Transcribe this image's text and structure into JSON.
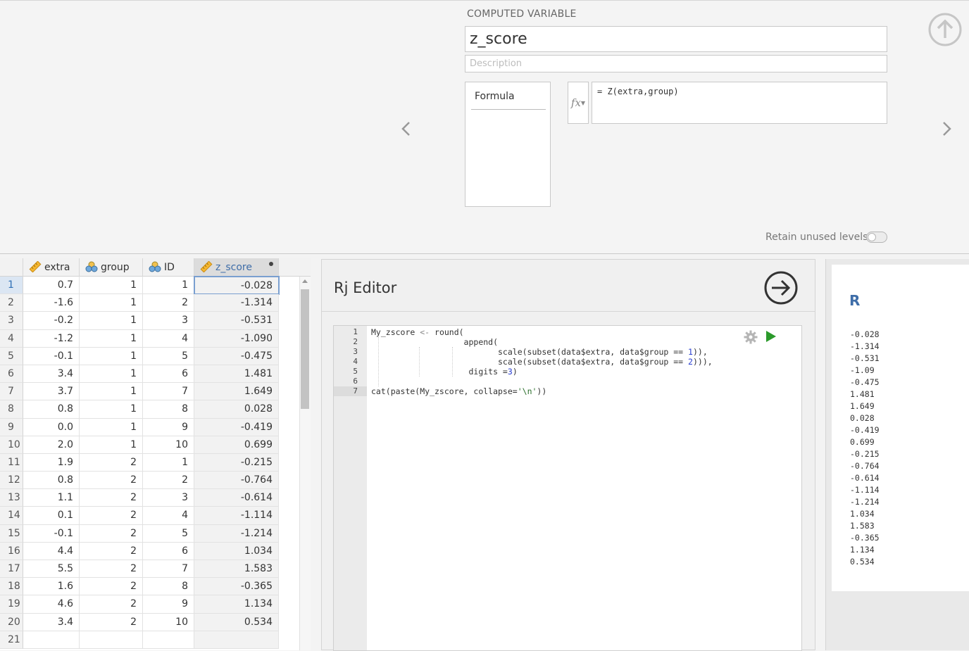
{
  "computed_variable": {
    "section_label": "COMPUTED VARIABLE",
    "name": "z_score",
    "description_placeholder": "Description",
    "formula_tab_label": "Formula",
    "fx_label": "fx",
    "formula_expression": "= Z(extra,group)",
    "retain_unused_levels_label": "Retain unused levels",
    "retain_unused_levels_on": false
  },
  "spreadsheet": {
    "columns": [
      {
        "name": "extra",
        "icon": "ruler-icon"
      },
      {
        "name": "group",
        "icon": "nominal-icon"
      },
      {
        "name": "ID",
        "icon": "nominal-icon"
      },
      {
        "name": "z_score",
        "icon": "ruler-icon",
        "selected": true
      }
    ],
    "rows": [
      [
        "1",
        "0.7",
        "1",
        "1",
        "-0.028"
      ],
      [
        "2",
        "-1.6",
        "1",
        "2",
        "-1.314"
      ],
      [
        "3",
        "-0.2",
        "1",
        "3",
        "-0.531"
      ],
      [
        "4",
        "-1.2",
        "1",
        "4",
        "-1.090"
      ],
      [
        "5",
        "-0.1",
        "1",
        "5",
        "-0.475"
      ],
      [
        "6",
        "3.4",
        "1",
        "6",
        "1.481"
      ],
      [
        "7",
        "3.7",
        "1",
        "7",
        "1.649"
      ],
      [
        "8",
        "0.8",
        "1",
        "8",
        "0.028"
      ],
      [
        "9",
        "0.0",
        "1",
        "9",
        "-0.419"
      ],
      [
        "10",
        "2.0",
        "1",
        "10",
        "0.699"
      ],
      [
        "11",
        "1.9",
        "2",
        "1",
        "-0.215"
      ],
      [
        "12",
        "0.8",
        "2",
        "2",
        "-0.764"
      ],
      [
        "13",
        "1.1",
        "2",
        "3",
        "-0.614"
      ],
      [
        "14",
        "0.1",
        "2",
        "4",
        "-1.114"
      ],
      [
        "15",
        "-0.1",
        "2",
        "5",
        "-1.214"
      ],
      [
        "16",
        "4.4",
        "2",
        "6",
        "1.034"
      ],
      [
        "17",
        "5.5",
        "2",
        "7",
        "1.583"
      ],
      [
        "18",
        "1.6",
        "2",
        "8",
        "-0.365"
      ],
      [
        "19",
        "4.6",
        "2",
        "9",
        "1.134"
      ],
      [
        "20",
        "3.4",
        "2",
        "10",
        "0.534"
      ],
      [
        "21",
        "",
        "",
        "",
        ""
      ]
    ]
  },
  "rj_editor": {
    "title": "Rj Editor",
    "line_numbers": [
      "1",
      "2",
      "3",
      "4",
      "5",
      "6",
      "7"
    ],
    "active_line": "7",
    "code_lines": [
      "My_zscore <- round(",
      "                   append(",
      "                          scale(subset(data$extra, data$group == 1)),",
      "                          scale(subset(data$extra, data$group == 2))),",
      "                    digits =3)",
      "",
      "cat(paste(My_zscore, collapse='\\n'))"
    ]
  },
  "output": {
    "title": "R",
    "lines": [
      "-0.028",
      "-1.314",
      "-0.531",
      "-1.09",
      "-0.475",
      "1.481",
      "1.649",
      "0.028",
      "-0.419",
      "0.699",
      "-0.215",
      "-0.764",
      "-0.614",
      "-1.114",
      "-1.214",
      "1.034",
      "1.583",
      "-0.365",
      "1.134",
      "0.534"
    ]
  },
  "colors": {
    "accent_blue": "#3e6da8",
    "run_green": "#2b9a2b"
  }
}
